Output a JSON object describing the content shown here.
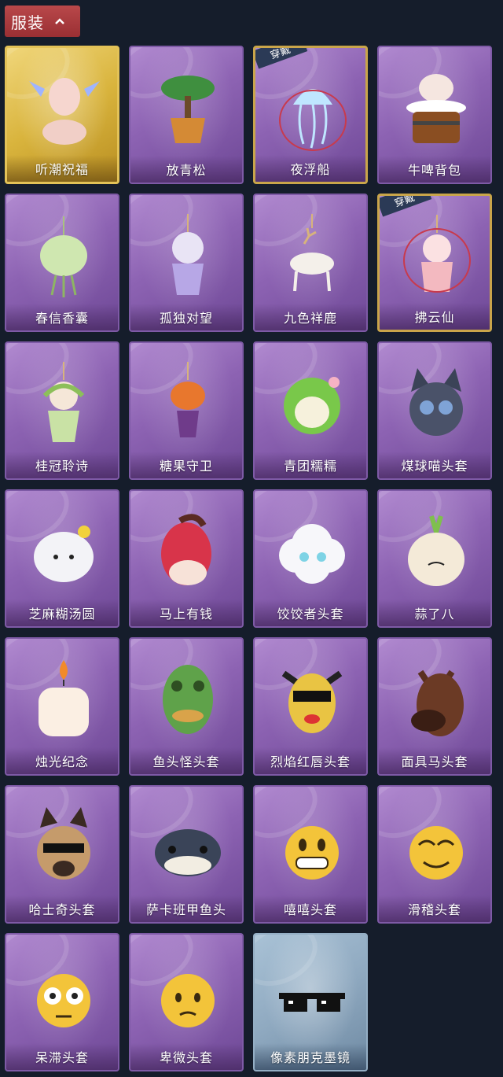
{
  "header": {
    "title": "服装"
  },
  "equipped_badge": "穿戴",
  "items": [
    {
      "label": "听潮祝福",
      "icon": "angel-figure-icon",
      "frame": "gold"
    },
    {
      "label": "放青松",
      "icon": "bonsai-pot-icon",
      "frame": "purple"
    },
    {
      "label": "夜浮船",
      "icon": "jellyfish-icon",
      "frame": "purple",
      "equipped": true
    },
    {
      "label": "牛啤背包",
      "icon": "cow-barrel-icon",
      "frame": "purple"
    },
    {
      "label": "春信香囊",
      "icon": "sachet-icon",
      "frame": "purple"
    },
    {
      "label": "孤独对望",
      "icon": "doll-pendant-icon",
      "frame": "purple"
    },
    {
      "label": "九色祥鹿",
      "icon": "deer-pendant-icon",
      "frame": "purple"
    },
    {
      "label": "拂云仙",
      "icon": "fairy-pendant-icon",
      "frame": "purple",
      "equipped": true
    },
    {
      "label": "桂冠聆诗",
      "icon": "laurel-fairy-icon",
      "frame": "purple"
    },
    {
      "label": "糖果守卫",
      "icon": "pumpkin-pendant-icon",
      "frame": "purple"
    },
    {
      "label": "青团糯糯",
      "icon": "green-dumpling-icon",
      "frame": "purple"
    },
    {
      "label": "煤球喵头套",
      "icon": "black-cat-head-icon",
      "frame": "purple"
    },
    {
      "label": "芝麻糊汤圆",
      "icon": "rice-ball-icon",
      "frame": "purple"
    },
    {
      "label": "马上有钱",
      "icon": "red-horse-head-icon",
      "frame": "purple"
    },
    {
      "label": "饺饺者头套",
      "icon": "cloud-head-icon",
      "frame": "purple"
    },
    {
      "label": "蒜了八",
      "icon": "garlic-head-icon",
      "frame": "purple"
    },
    {
      "label": "烛光纪念",
      "icon": "candle-head-icon",
      "frame": "purple"
    },
    {
      "label": "鱼头怪头套",
      "icon": "fish-man-head-icon",
      "frame": "purple"
    },
    {
      "label": "烈焰红唇头套",
      "icon": "yellow-mask-sunglasses-icon",
      "frame": "purple"
    },
    {
      "label": "面具马头套",
      "icon": "horse-mask-icon",
      "frame": "purple"
    },
    {
      "label": "哈士奇头套",
      "icon": "dog-sunglasses-icon",
      "frame": "purple"
    },
    {
      "label": "萨卡班甲鱼头",
      "icon": "fish-head-icon",
      "frame": "purple"
    },
    {
      "label": "嘻嘻头套",
      "icon": "grin-emoji-icon",
      "frame": "purple"
    },
    {
      "label": "滑稽头套",
      "icon": "funny-emoji-icon",
      "frame": "purple"
    },
    {
      "label": "呆滞头套",
      "icon": "flushed-emoji-icon",
      "frame": "purple"
    },
    {
      "label": "卑微头套",
      "icon": "pleading-emoji-icon",
      "frame": "purple"
    },
    {
      "label": "像素朋克墨镜",
      "icon": "pixel-sunglasses-icon",
      "frame": "blue"
    }
  ]
}
